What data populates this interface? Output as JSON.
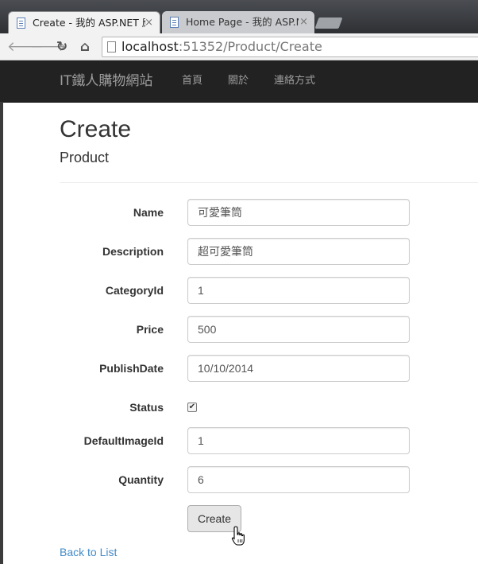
{
  "browser": {
    "tabs": [
      {
        "title": "Create - 我的 ASP.NET 應",
        "active": true
      },
      {
        "title": "Home Page - 我的 ASP.N",
        "active": false
      }
    ],
    "url_host": "localhost",
    "url_path": ":51352/Product/Create"
  },
  "navbar": {
    "brand": "IT鐵人購物網站",
    "links": [
      "首頁",
      "關於",
      "連絡方式"
    ]
  },
  "page": {
    "title": "Create",
    "subtitle": "Product"
  },
  "form": {
    "fields": [
      {
        "label": "Name",
        "value": "可愛筆筒"
      },
      {
        "label": "Description",
        "value": "超可愛筆筒"
      },
      {
        "label": "CategoryId",
        "value": "1"
      },
      {
        "label": "Price",
        "value": "500"
      },
      {
        "label": "PublishDate",
        "value": "10/10/2014"
      },
      {
        "label": "Status",
        "value": "checked"
      },
      {
        "label": "DefaultImageId",
        "value": "1"
      },
      {
        "label": "Quantity",
        "value": "6"
      }
    ],
    "submit_label": "Create"
  },
  "footer": {
    "back_link": "Back to List"
  },
  "icons": {
    "tab_close": "close-icon",
    "back": "back-arrow-icon",
    "forward": "forward-arrow-icon",
    "reload": "reload-icon",
    "home": "home-icon",
    "checkbox": "checkmark-icon",
    "cursor": "hand-pointer-icon"
  },
  "colors": {
    "navbar_bg": "#222222",
    "link": "#428bca",
    "button_bg": "#e6e6e6"
  }
}
